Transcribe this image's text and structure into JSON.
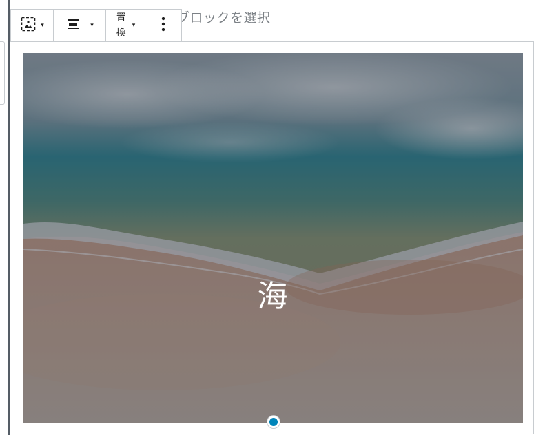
{
  "editor": {
    "placeholder_hint": "ブロックを選択"
  },
  "toolbar": {
    "change_image_icon": "image-placeholder-icon",
    "change_image_caret": "▾",
    "align_icon": "align-center-icon",
    "align_caret": "▾",
    "replace_label": "置換",
    "replace_caret": "▾",
    "more_icon": "more-vertical-icon"
  },
  "cover": {
    "title": "海",
    "image_description": "aerial-beach-waves",
    "handle_color": "#0085ba"
  }
}
